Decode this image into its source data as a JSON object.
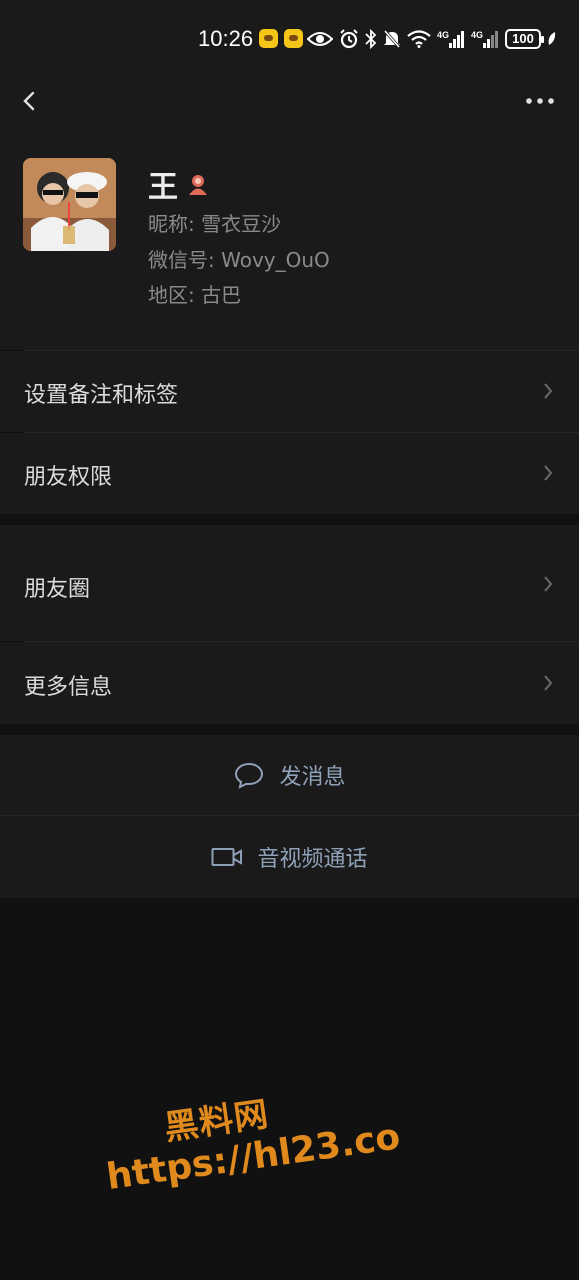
{
  "status_bar": {
    "time": "10:26",
    "battery": "100",
    "icons": [
      "app-badge-icon",
      "app-badge-icon",
      "eye-icon",
      "alarm-icon",
      "bluetooth-icon",
      "mute-icon",
      "wifi-icon",
      "signal-4g-icon",
      "signal-4g-icon",
      "battery-icon",
      "leaf-icon"
    ]
  },
  "nav": {
    "back_icon": "chevron-left-icon",
    "more_icon": "more-dots-icon"
  },
  "profile": {
    "name": "王",
    "gender_icon": "female-icon",
    "nickname_label": "昵称:",
    "nickname": "雪衣豆沙",
    "wechat_id_label": "微信号:",
    "wechat_id": "Wovy_OuO",
    "region_label": "地区:",
    "region": "古巴"
  },
  "menu": {
    "remark_tags": "设置备注和标签",
    "friend_permissions": "朋友权限",
    "moments": "朋友圈",
    "more_info": "更多信息"
  },
  "actions": {
    "send_message": "发消息",
    "video_call": "音视频通话"
  },
  "watermark": {
    "title": "黑料网",
    "url": "https://hl23.co"
  },
  "colors": {
    "background": "#111111",
    "surface": "#1a1a1a",
    "action_text": "#8fa1b8",
    "watermark": "#e08a1e"
  }
}
